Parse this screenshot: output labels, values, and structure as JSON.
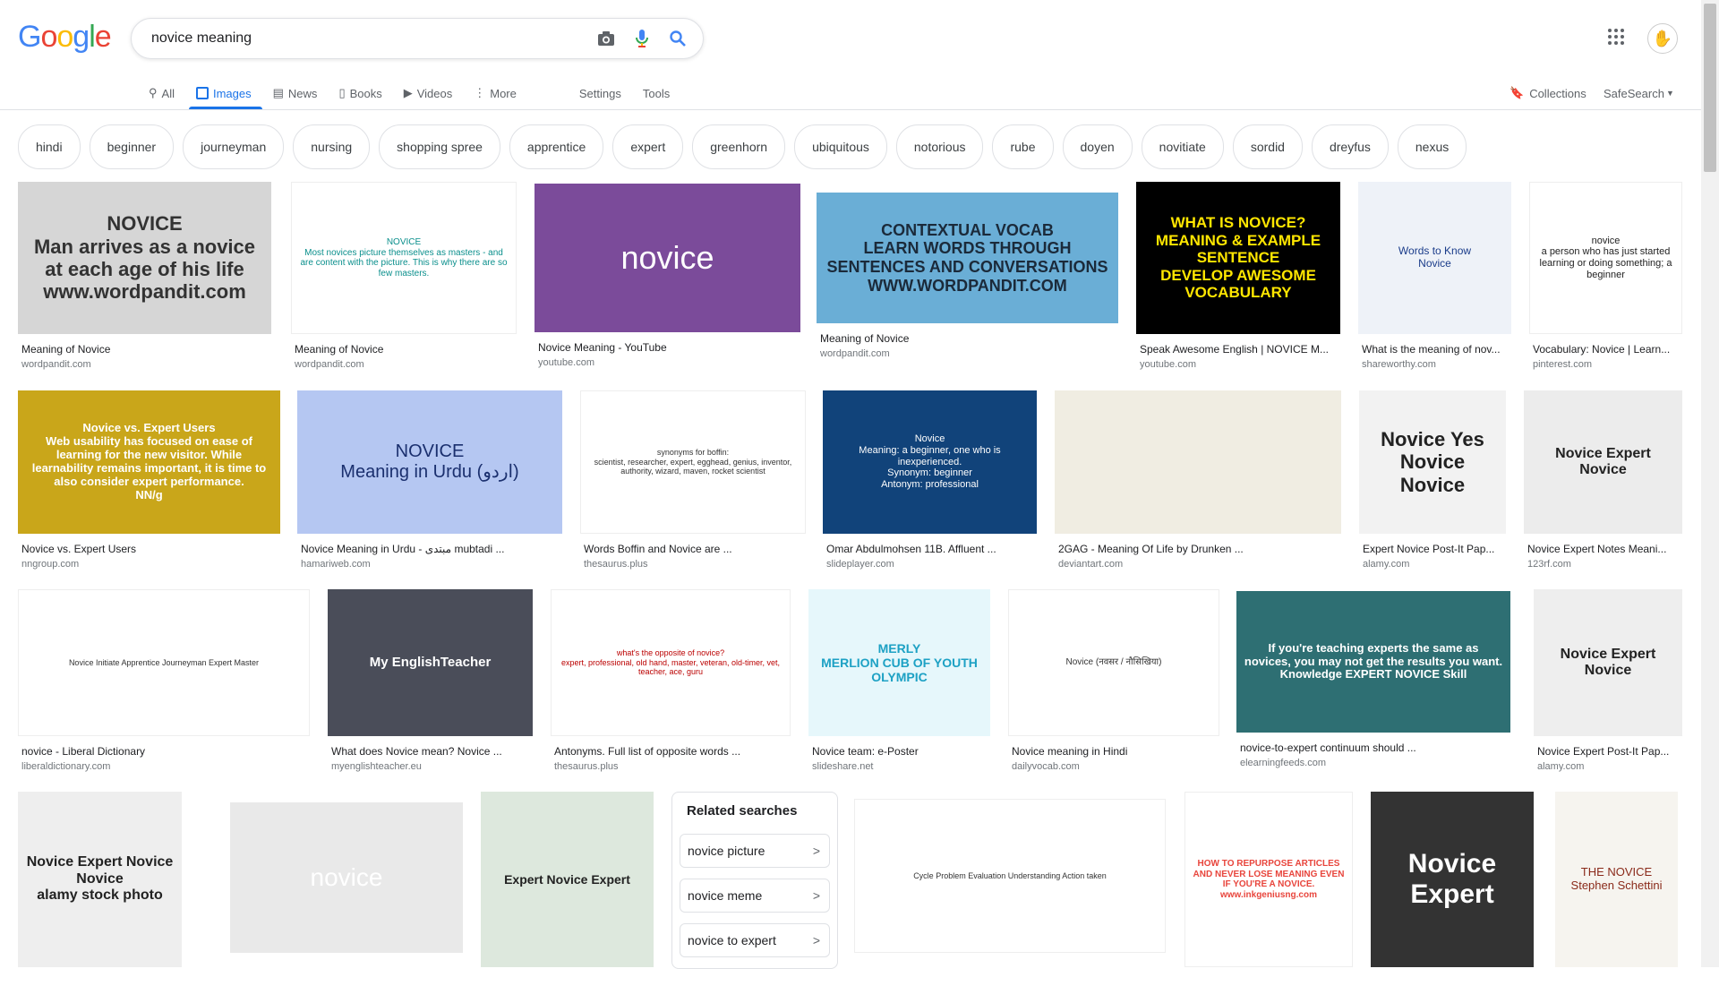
{
  "logo": "Google",
  "search": {
    "query": "novice meaning"
  },
  "tabs": [
    "All",
    "Images",
    "News",
    "Books",
    "Videos",
    "More"
  ],
  "settings_label": "Settings",
  "tools_label": "Tools",
  "collections_label": "Collections",
  "safesearch_label": "SafeSearch",
  "chips": [
    "hindi",
    "beginner",
    "journeyman",
    "nursing",
    "shopping spree",
    "apprentice",
    "expert",
    "greenhorn",
    "ubiquitous",
    "notorious",
    "rube",
    "doyen",
    "novitiate",
    "sordid",
    "dreyfus",
    "nexus"
  ],
  "results": [
    {
      "caption": "Meaning of Novice",
      "source": "wordpandit.com",
      "text": "NOVICE\nMan arrives as a novice at each age of his life\nwww.wordpandit.com"
    },
    {
      "caption": "Meaning of Novice",
      "source": "wordpandit.com",
      "text": "NOVICE\nMost novices picture themselves as masters - and are content with the picture. This is why there are so few masters."
    },
    {
      "caption": "Novice Meaning - YouTube",
      "source": "youtube.com",
      "text": "novice"
    },
    {
      "caption": "Meaning of Novice",
      "source": "wordpandit.com",
      "text": "CONTEXTUAL VOCAB\nLEARN WORDS THROUGH SENTENCES AND CONVERSATIONS\nWWW.WORDPANDIT.COM"
    },
    {
      "caption": "Speak Awesome English | NOVICE M...",
      "source": "youtube.com",
      "text": "WHAT IS NOVICE?\nMEANING & EXAMPLE SENTENCE\nDEVELOP AWESOME VOCABULARY"
    },
    {
      "caption": "What is the meaning of nov...",
      "source": "shareworthy.com",
      "text": "Words to Know\nNovice"
    },
    {
      "caption": "Vocabulary: Novice | Learn...",
      "source": "pinterest.com",
      "text": "novice\na person who has just started learning or doing something; a beginner"
    },
    {
      "caption": "Novice vs. Expert Users",
      "source": "nngroup.com",
      "text": "Novice vs. Expert Users\nWeb usability has focused on ease of learning for the new visitor. While learnability remains important, it is time to also consider expert performance.\nNN/g"
    },
    {
      "caption": "Novice Meaning in Urdu - مبتدی mubtadi ...",
      "source": "hamariweb.com",
      "text": "NOVICE\nMeaning in Urdu (اردو)"
    },
    {
      "caption": "Words Boffin and Novice are ...",
      "source": "thesaurus.plus",
      "text": "synonyms for boffin:\nscientist, researcher, expert, egghead, genius, inventor, authority, wizard, maven, rocket scientist"
    },
    {
      "caption": "Omar Abdulmohsen 11B. Affluent ...",
      "source": "slideplayer.com",
      "text": "Novice\nMeaning: a beginner, one who is inexperienced.\nSynonym: beginner\nAntonym: professional"
    },
    {
      "caption": "2GAG - Meaning Of Life by Drunken ...",
      "source": "deviantart.com",
      "text": ""
    },
    {
      "caption": "Expert Novice Post-It Pap...",
      "source": "alamy.com",
      "text": "Novice Yes Novice Novice"
    },
    {
      "caption": "Novice Expert Notes Meani...",
      "source": "123rf.com",
      "text": "Novice Expert Novice"
    },
    {
      "caption": "novice - Liberal Dictionary",
      "source": "liberaldictionary.com",
      "text": "Novice Initiate Apprentice Journeyman Expert Master"
    },
    {
      "caption": "What does Novice mean? Novice ...",
      "source": "myenglishteacher.eu",
      "text": "My EnglishTeacher"
    },
    {
      "caption": "Antonyms. Full list of opposite words ...",
      "source": "thesaurus.plus",
      "text": "what's the opposite of novice?\nexpert, professional, old hand, master, veteran, old-timer, vet, teacher, ace, guru"
    },
    {
      "caption": "Novice team: e-Poster",
      "source": "slideshare.net",
      "text": "MERLY\nMERLION CUB OF YOUTH OLYMPIC"
    },
    {
      "caption": "Novice meaning in Hindi",
      "source": "dailyvocab.com",
      "text": "Novice (नवसर / नौसिखिया)"
    },
    {
      "caption": "novice-to-expert continuum should ...",
      "source": "elearningfeeds.com",
      "text": "If you're teaching experts the same as novices, you may not get the results you want.\nKnowledge EXPERT NOVICE Skill"
    },
    {
      "caption": "Novice Expert Post-It Pap...",
      "source": "alamy.com",
      "text": "Novice Expert Novice"
    },
    {
      "caption": "",
      "source": "",
      "text": "Novice Expert Novice Novice\nalamy stock photo"
    },
    {
      "caption": "",
      "source": "",
      "text": "novice"
    },
    {
      "caption": "",
      "source": "",
      "text": "Expert Novice Expert"
    },
    {
      "caption": "",
      "source": "",
      "text": "Cycle Problem Evaluation Understanding Action taken"
    },
    {
      "caption": "",
      "source": "",
      "text": "HOW TO REPURPOSE ARTICLES AND NEVER LOSE MEANING EVEN IF YOU'RE A NOVICE.\nwww.inkgeniusng.com"
    },
    {
      "caption": "",
      "source": "",
      "text": "Novice Expert"
    },
    {
      "caption": "",
      "source": "",
      "text": "THE NOVICE\nStephen Schettini"
    }
  ],
  "related": {
    "title": "Related searches",
    "items": [
      "novice picture",
      "novice meme",
      "novice to expert"
    ]
  },
  "colors": {
    "accent": "#1a73e8",
    "border": "#dfe1e5",
    "source_text": "#70757a"
  }
}
